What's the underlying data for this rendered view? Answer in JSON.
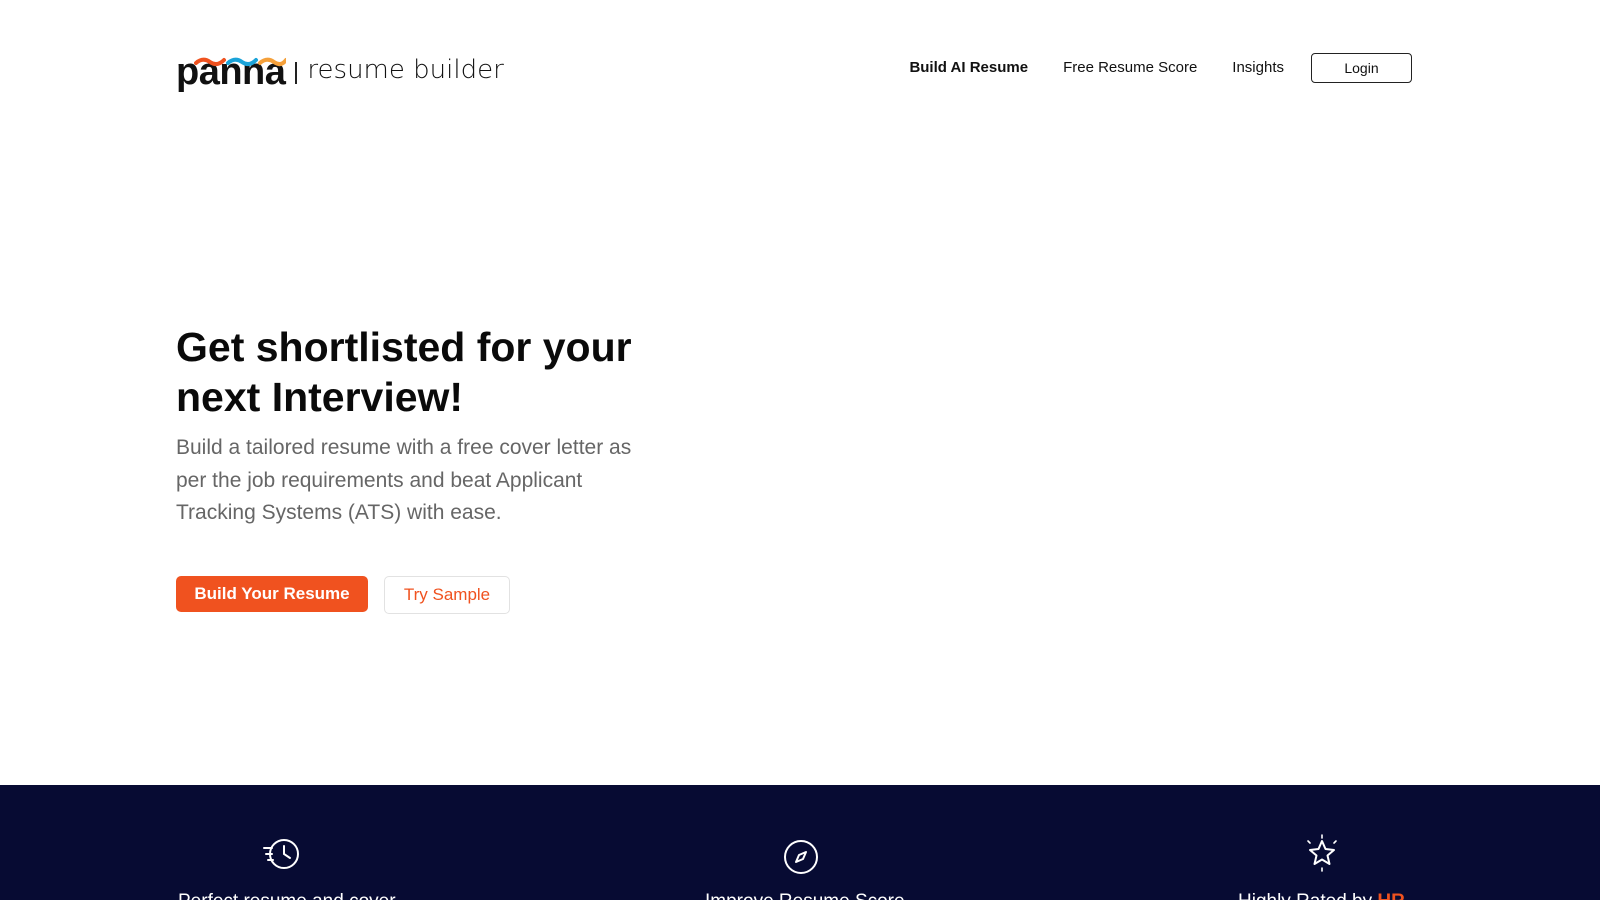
{
  "brand": {
    "name": "panna",
    "tagline": "resume builder",
    "wave_colors": [
      "#f0521f",
      "#1aa3d9",
      "#f5a03a"
    ]
  },
  "nav": {
    "items": [
      {
        "label": "Build AI Resume",
        "active": true
      },
      {
        "label": "Free Resume Score",
        "active": false
      },
      {
        "label": "Insights",
        "active": false
      }
    ],
    "login_label": "Login"
  },
  "hero": {
    "title": "Get shortlisted for your next Interview!",
    "description": "Build a tailored resume with a free cover letter as per the job requirements and beat Applicant Tracking Systems (ATS) with ease.",
    "primary_cta": "Build Your Resume",
    "secondary_cta": "Try Sample"
  },
  "features": [
    {
      "icon": "history-icon",
      "label": "Perfect resume and cover"
    },
    {
      "icon": "compass-icon",
      "label": "Improve Resume Score"
    },
    {
      "icon": "sparkle-star-icon",
      "label_prefix": "Highly Rated by ",
      "label_highlight": "HR"
    }
  ],
  "colors": {
    "accent": "#f0521f",
    "band_background": "#070b33",
    "text_muted": "#666666"
  }
}
